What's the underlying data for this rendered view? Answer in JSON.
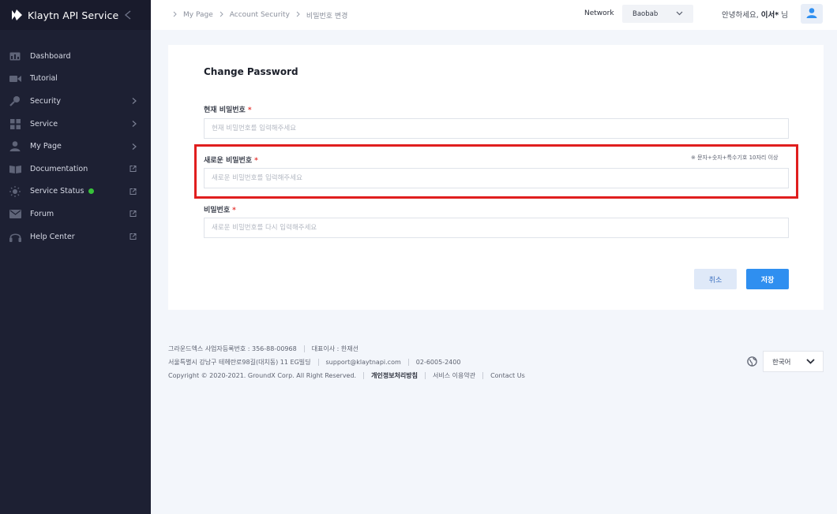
{
  "sidebar": {
    "brand": "Klaytn API Service",
    "items": [
      {
        "label": "Dashboard",
        "icon": "dashboard-icon",
        "right": ""
      },
      {
        "label": "Tutorial",
        "icon": "video-icon",
        "right": ""
      },
      {
        "label": "Security",
        "icon": "key-icon",
        "right": "chevron-right-icon"
      },
      {
        "label": "Service",
        "icon": "grid-icon",
        "right": "chevron-right-icon"
      },
      {
        "label": "My Page",
        "icon": "user-icon",
        "right": "chevron-right-icon"
      },
      {
        "label": "Documentation",
        "icon": "book-icon",
        "right": "external-link-icon"
      },
      {
        "label": "Service Status",
        "icon": "sun-icon",
        "right": "external-link-icon"
      },
      {
        "label": "Forum",
        "icon": "mail-icon",
        "right": "external-link-icon"
      },
      {
        "label": "Help Center",
        "icon": "headset-icon",
        "right": "external-link-icon"
      }
    ],
    "status_color": "#37c23a"
  },
  "header": {
    "breadcrumb": [
      "My Page",
      "Account Security",
      "비밀번호 변경"
    ],
    "network_label": "Network",
    "network_value": "Baobab",
    "greeting_prefix": "안녕하세요,",
    "user_name": "이서*",
    "greeting_suffix": "님"
  },
  "form": {
    "title": "Change Password",
    "current": {
      "label": "현재 비밀번호",
      "placeholder": "현재 비밀번호를 입력해주세요"
    },
    "new": {
      "label": "새로운 비밀번호",
      "placeholder": "새로운 비밀번호를 입력해주세요",
      "hint": "※ 문자+숫자+특수기호 10자리 이상"
    },
    "confirm": {
      "label": "비밀번호",
      "placeholder": "새로운 비밀번호를 다시 입력해주세요"
    },
    "required_mark": "*",
    "cancel_label": "취소",
    "save_label": "저장"
  },
  "footer": {
    "company": "그라운드엑스 사업자등록번호 : 356-88-00968",
    "ceo": "대표이사 : 한재선",
    "address": "서울특별시 강남구 테헤란로98길(대치동) 11 EG빌딩",
    "email": "support@klaytnapi.com",
    "phone": "02-6005-2400",
    "copyright": "Copyright © 2020-2021. GroundX Corp. All Right Reserved.",
    "privacy": "개인정보처리방침",
    "terms": "서비스 이용약관",
    "contact": "Contact Us",
    "language": "한국어"
  },
  "colors": {
    "sidebar_bg": "#1d2033",
    "accent": "#2f8ff0",
    "highlight": "#e01e1e"
  }
}
